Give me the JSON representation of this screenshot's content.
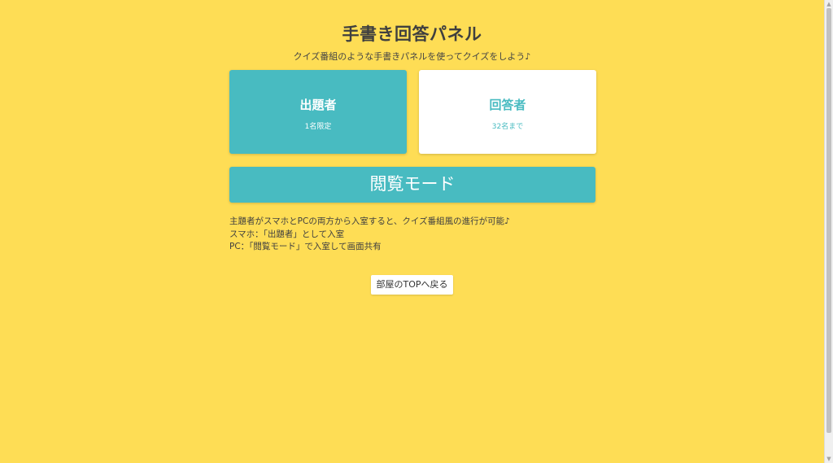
{
  "header": {
    "title": "手書き回答パネル",
    "subtitle": "クイズ番組のような手書きパネルを使ってクイズをしよう♪"
  },
  "roles": {
    "host": {
      "title": "出題者",
      "limit": "1名限定"
    },
    "answerer": {
      "title": "回答者",
      "limit": "32名まで"
    }
  },
  "view_mode": {
    "label": "閲覧モード"
  },
  "info": {
    "lines": [
      "主題者がスマホとPCの両方から入室すると、クイズ番組風の進行が可能♪",
      "スマホ：「出題者」として入室",
      "PC：「閲覧モード」で入室して画面共有"
    ]
  },
  "footer": {
    "back_label": "部屋のTOPへ戻る"
  },
  "colors": {
    "background": "#fedd55",
    "accent": "#48bbc1",
    "card_white": "#ffffff",
    "text": "#3f3f3f"
  }
}
